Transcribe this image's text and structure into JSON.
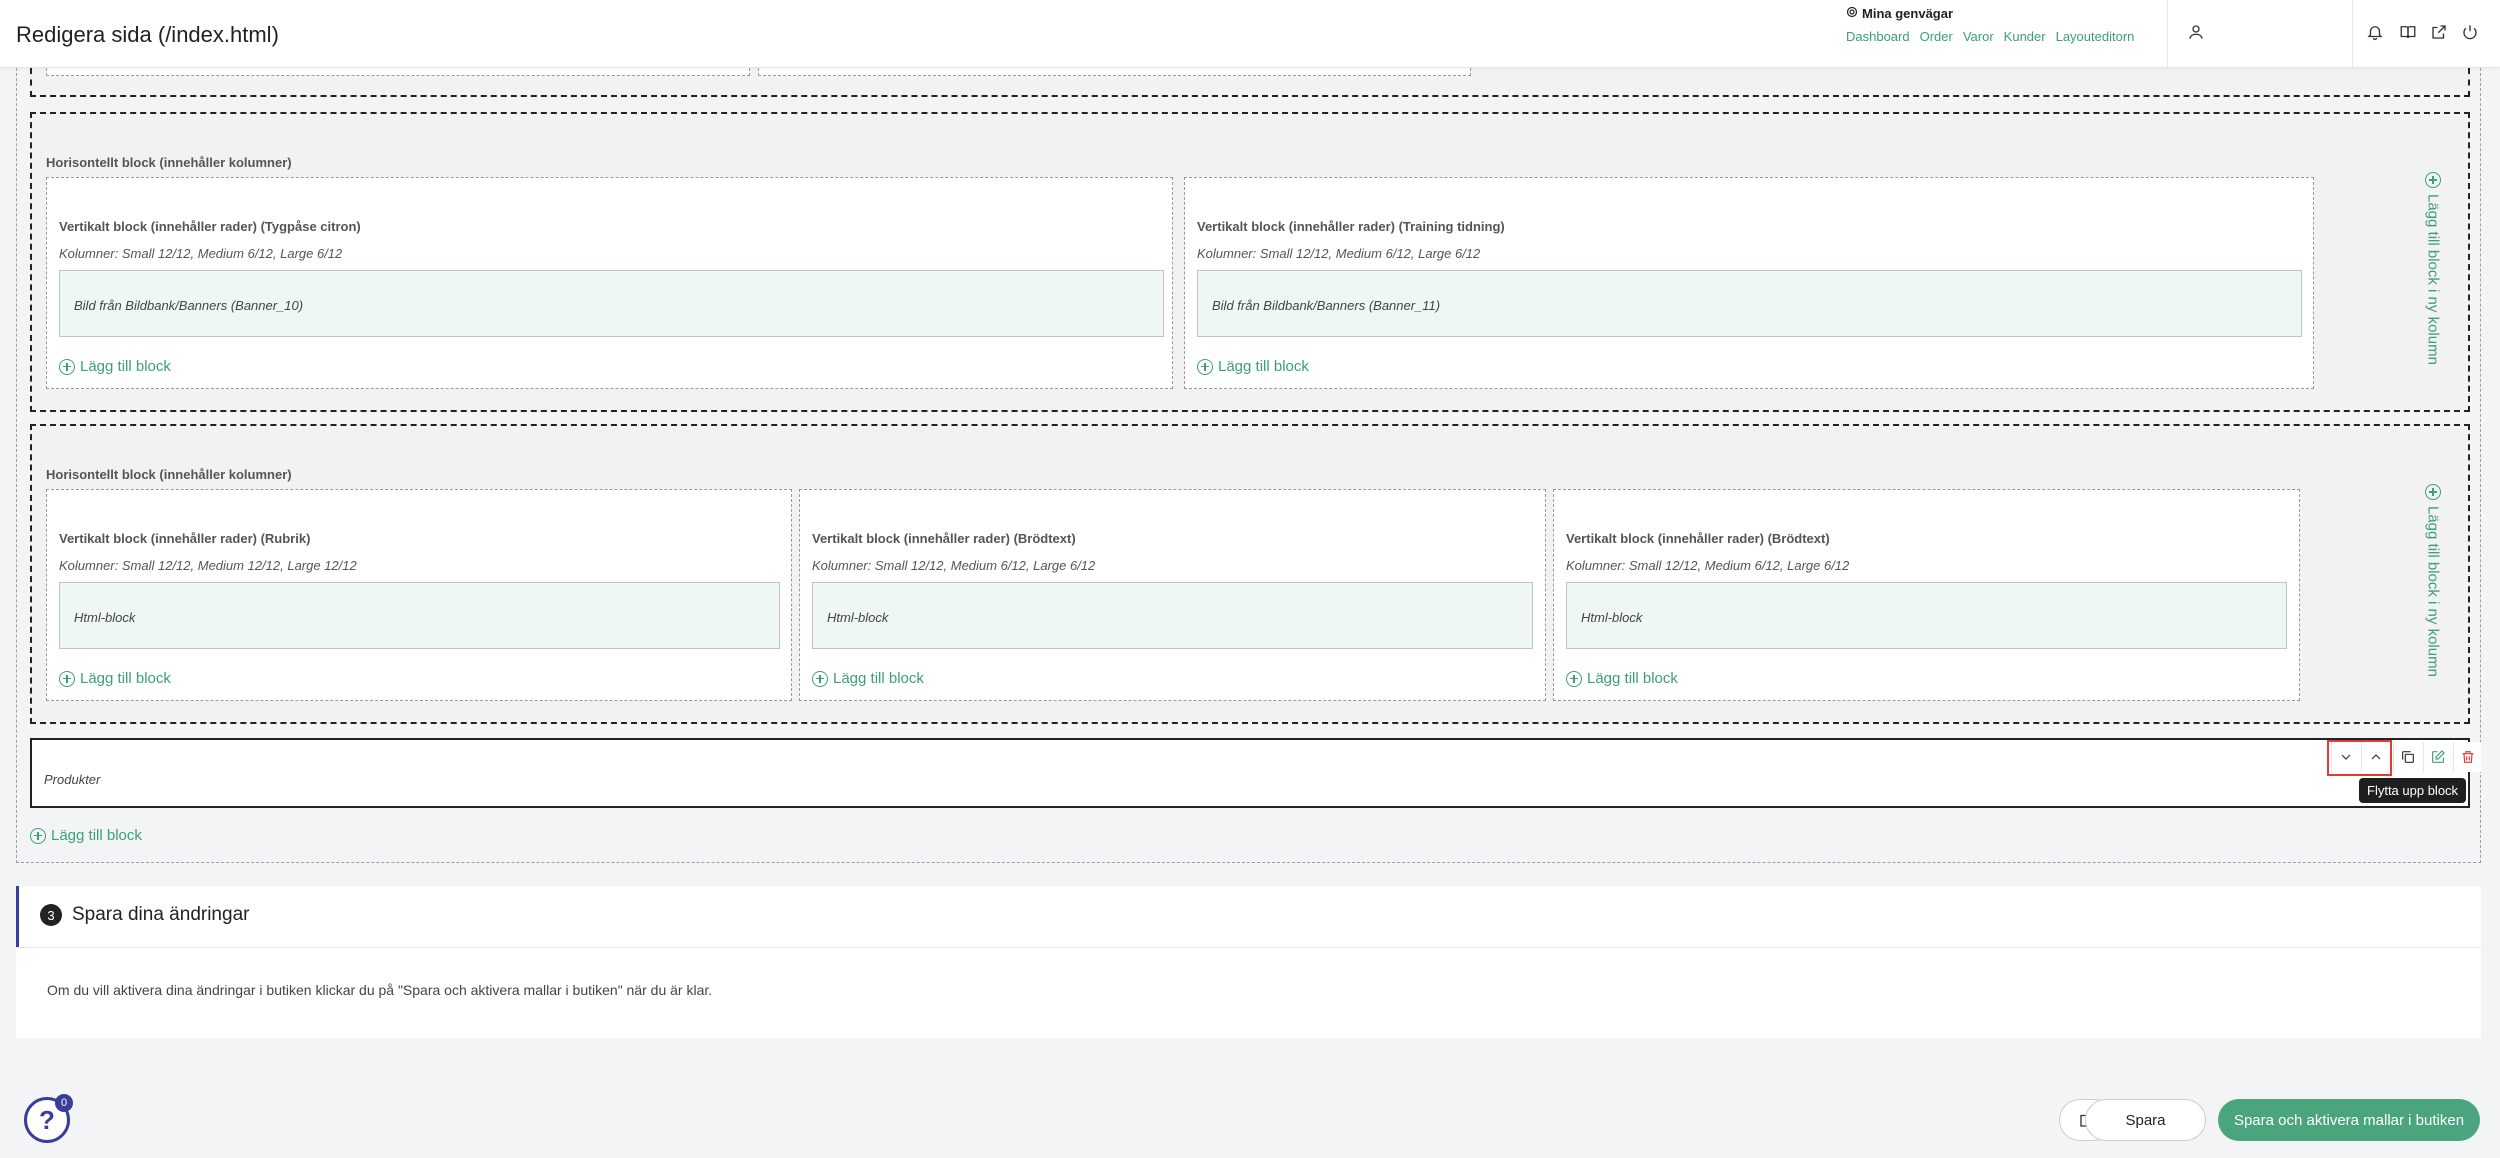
{
  "header": {
    "title": "Redigera sida (/index.html)",
    "shortcuts_title": "Mina genvägar",
    "shortcut_links": [
      "Dashboard",
      "Order",
      "Varor",
      "Kunder",
      "Layouteditorn"
    ],
    "icons": [
      "user-icon",
      "bell-icon",
      "book-icon",
      "external-link-icon",
      "power-icon"
    ]
  },
  "rows": [
    {
      "title": "Horisontellt block (innehåller kolumner)",
      "add_column_label": "Lägg till block i ny kolumn",
      "columns": [
        {
          "title": "Vertikalt block (innehåller rader) (Tygpåse citron)",
          "meta": "Kolumner: Small 12/12, Medium 6/12, Large 6/12",
          "block": "Bild från Bildbank/Banners (Banner_10)",
          "add_label": "Lägg till block"
        },
        {
          "title": "Vertikalt block (innehåller rader) (Training tidning)",
          "meta": "Kolumner: Small 12/12, Medium 6/12, Large 6/12",
          "block": "Bild från Bildbank/Banners (Banner_11)",
          "add_label": "Lägg till block"
        }
      ]
    },
    {
      "title": "Horisontellt block (innehåller kolumner)",
      "add_column_label": "Lägg till block i ny kolumn",
      "columns": [
        {
          "title": "Vertikalt block (innehåller rader) (Rubrik)",
          "meta": "Kolumner: Small 12/12, Medium 12/12, Large 12/12",
          "block": "Html-block",
          "add_label": "Lägg till block"
        },
        {
          "title": "Vertikalt block (innehåller rader) (Brödtext)",
          "meta": "Kolumner: Small 12/12, Medium 6/12, Large 6/12",
          "block": "Html-block",
          "add_label": "Lägg till block"
        },
        {
          "title": "Vertikalt block (innehåller rader) (Brödtext)",
          "meta": "Kolumner: Small 12/12, Medium 6/12, Large 6/12",
          "block": "Html-block",
          "add_label": "Lägg till block"
        }
      ]
    }
  ],
  "produkter": {
    "label": "Produkter",
    "tooltip": "Flytta upp block",
    "tools": [
      "chevron-down-icon",
      "chevron-up-icon",
      "copy-icon",
      "edit-icon",
      "trash-icon"
    ]
  },
  "add_block_bottom": "Lägg till block",
  "save_section": {
    "step": "3",
    "title": "Spara dina ändringar",
    "text": "Om du vill aktivera dina ändringar i butiken klickar du på \"Spara och aktivera mallar i butiken\" när du är klar."
  },
  "footer": {
    "help_badge": "0",
    "save_label": "Spara",
    "activate_label": "Spara och aktivera mallar i butiken"
  },
  "colors": {
    "accent": "#3c9f77",
    "primary_button": "#4aa57f",
    "highlight": "#e53935",
    "help": "#3a3d9a"
  }
}
